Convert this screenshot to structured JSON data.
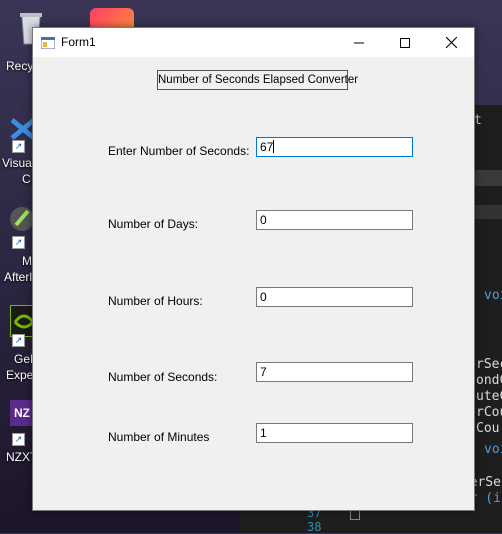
{
  "desktop": {
    "icons": [
      {
        "label": "Recy",
        "icon": "recycle-bin-icon"
      },
      {
        "label": "Visua",
        "label2": "C",
        "icon": "visual-studio-icon"
      },
      {
        "label": "M",
        "label2": "Afterl",
        "icon": "afterburner-icon"
      },
      {
        "label": "GeF",
        "label2": "Expe",
        "icon": "nvidia-icon"
      },
      {
        "label": "NZXT",
        "icon": "nzxt-icon"
      }
    ],
    "code_fragments": [
      "t",
      "voi",
      "rSec",
      "ondC",
      "uteC",
      "rCou",
      "Cou",
      "voi",
      "userSec",
      "for (i"
    ],
    "line_numbers": [
      "37",
      "38"
    ]
  },
  "window": {
    "title": "Form1",
    "minimize_icon": "minimize-icon",
    "maximize_icon": "maximize-icon",
    "close_icon": "close-icon"
  },
  "form": {
    "heading": "Number of Seconds Elapsed Converter",
    "fields": [
      {
        "label": "Enter Number of Seconds:",
        "value": "67"
      },
      {
        "label": "Number of Days:",
        "value": "0"
      },
      {
        "label": "Number of Hours:",
        "value": "0"
      },
      {
        "label": "Number of Seconds:",
        "value": "7"
      },
      {
        "label": "Number of Minutes",
        "value": "1"
      }
    ]
  },
  "colors": {
    "focus_border": "#0078d7",
    "window_bg": "#f0f0f0"
  }
}
